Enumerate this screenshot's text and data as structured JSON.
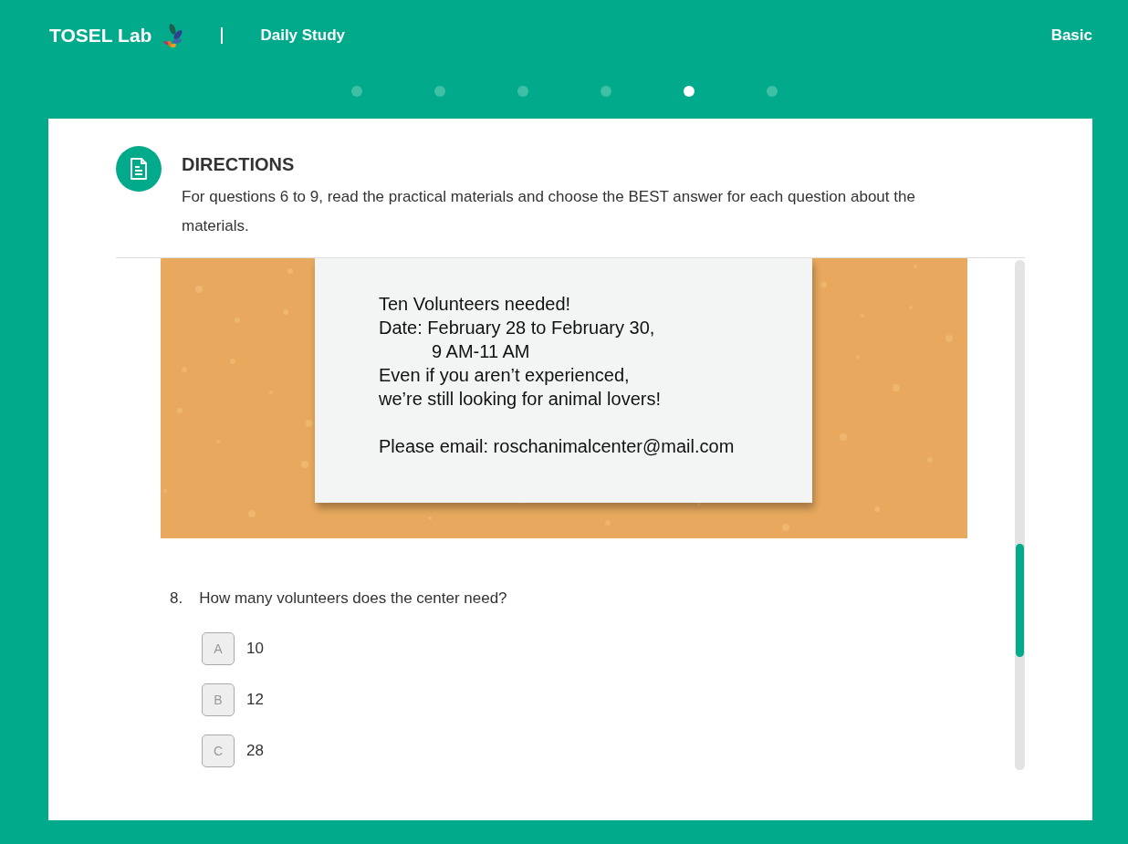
{
  "header": {
    "brand": "TOSEL Lab",
    "section": "Daily Study",
    "level": "Basic"
  },
  "steps": [
    {
      "selected": false
    },
    {
      "selected": false
    },
    {
      "selected": false
    },
    {
      "selected": false
    },
    {
      "selected": true
    },
    {
      "selected": false
    }
  ],
  "directions": {
    "title": "DIRECTIONS",
    "text": "For questions 6 to 9, read the practical materials and choose the BEST answer for each question about the materials."
  },
  "notice": {
    "lines": [
      {
        "text": "Ten Volunteers needed!",
        "kind": "line"
      },
      {
        "text": "Date: February 28 to February 30,",
        "kind": "line"
      },
      {
        "text": "9 AM-11 AM",
        "kind": "indent"
      },
      {
        "text": "Even if you aren’t experienced,",
        "kind": "line"
      },
      {
        "text": "we’re still looking for animal lovers!",
        "kind": "line"
      },
      {
        "text": "Please email: roschanimalcenter@mail.com",
        "kind": "gap"
      }
    ]
  },
  "question": {
    "number": "8.",
    "text": "How many volunteers does the center need?",
    "options": [
      {
        "letter": "A",
        "text": "10",
        "selected": false
      },
      {
        "letter": "B",
        "text": "12",
        "selected": false
      },
      {
        "letter": "C",
        "text": "28",
        "selected": false
      }
    ]
  }
}
